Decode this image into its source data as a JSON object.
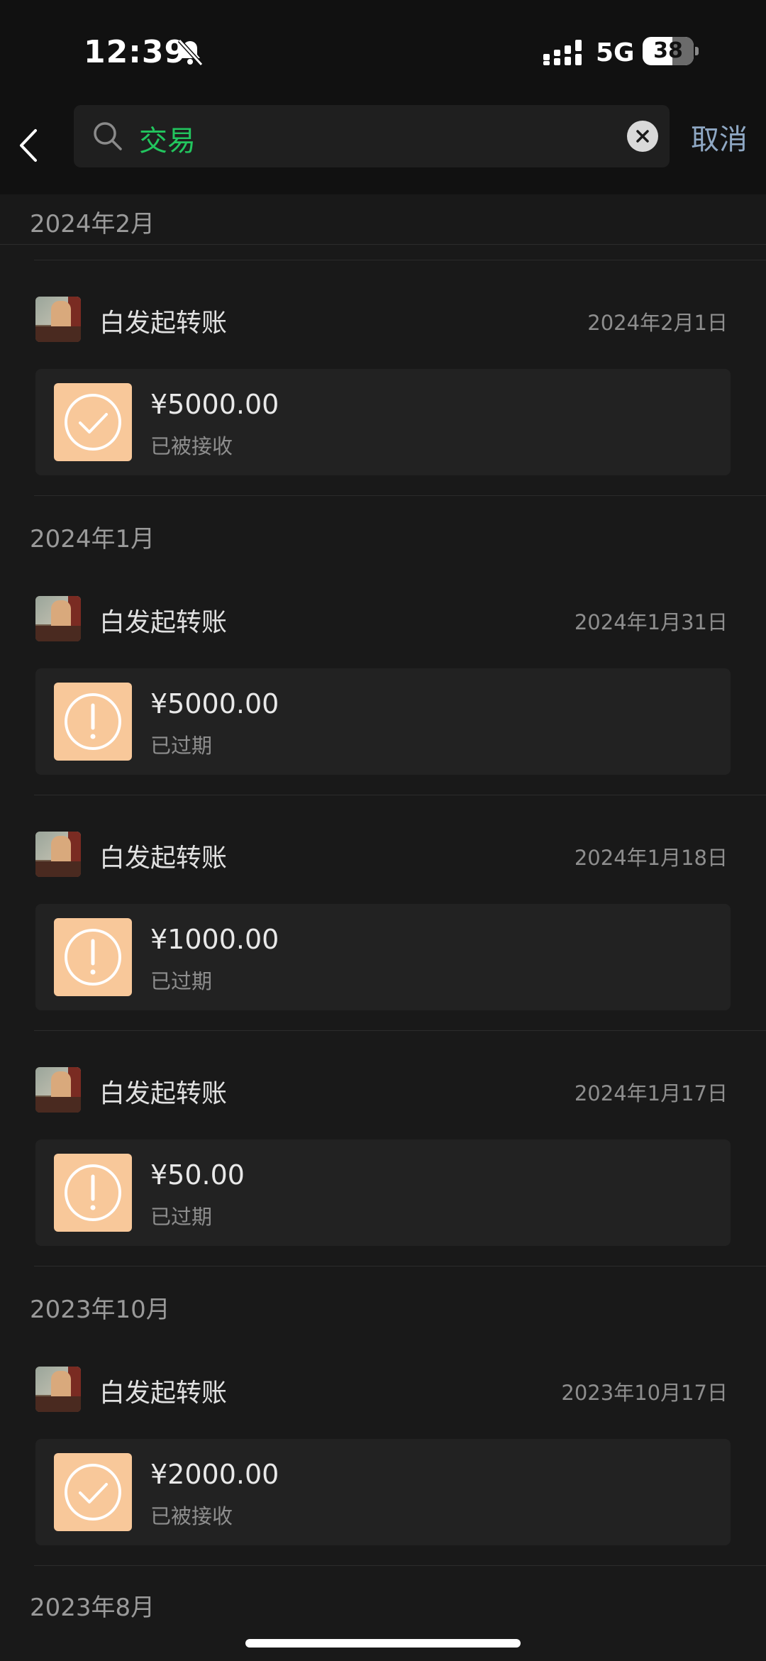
{
  "status": {
    "time": "12:39",
    "network": "5G",
    "battery": "38"
  },
  "search": {
    "query": "交易",
    "cancel": "取消"
  },
  "groups": [
    {
      "month": "2024年2月",
      "items": [
        {
          "title": "白发起转账",
          "date": "2024年2月1日",
          "amount": "¥5000.00",
          "status": "已被接收",
          "icon": "check-circle-icon"
        }
      ]
    },
    {
      "month": "2024年1月",
      "items": [
        {
          "title": "白发起转账",
          "date": "2024年1月31日",
          "amount": "¥5000.00",
          "status": "已过期",
          "icon": "exclamation-circle-icon"
        },
        {
          "title": "白发起转账",
          "date": "2024年1月18日",
          "amount": "¥1000.00",
          "status": "已过期",
          "icon": "exclamation-circle-icon"
        },
        {
          "title": "白发起转账",
          "date": "2024年1月17日",
          "amount": "¥50.00",
          "status": "已过期",
          "icon": "exclamation-circle-icon"
        }
      ]
    },
    {
      "month": "2023年10月",
      "items": [
        {
          "title": "白发起转账",
          "date": "2023年10月17日",
          "amount": "¥2000.00",
          "status": "已被接收",
          "icon": "check-circle-icon"
        }
      ]
    },
    {
      "month": "2023年8月",
      "items": []
    }
  ],
  "colors": {
    "accent": "#22c55e",
    "cancel": "#8fa8c4",
    "transfer_icon_bg": "#f8c89a"
  }
}
